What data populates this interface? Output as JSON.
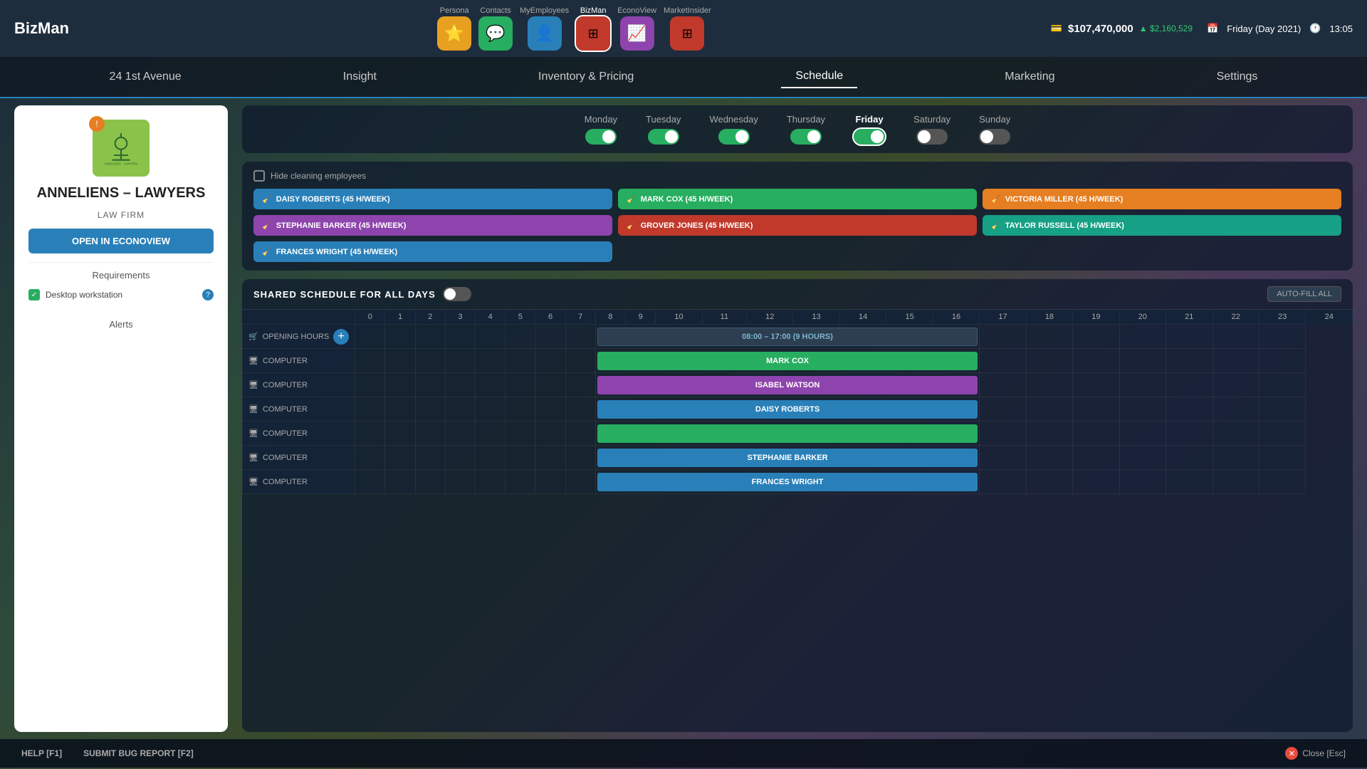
{
  "app": {
    "logo": "BizMan",
    "nav": [
      {
        "id": "persona",
        "label": "Persona",
        "icon": "⭐",
        "color": "#e8a020"
      },
      {
        "id": "contacts",
        "label": "Contacts",
        "icon": "💬",
        "color": "#27ae60"
      },
      {
        "id": "myemployees",
        "label": "MyEmployees",
        "icon": "👤",
        "color": "#2980b9"
      },
      {
        "id": "bizman",
        "label": "BizMan",
        "icon": "▦",
        "color": "#c0392b",
        "active": true
      },
      {
        "id": "econoview",
        "label": "EconoView",
        "icon": "📈",
        "color": "#8e44ad"
      },
      {
        "id": "marketinsider",
        "label": "MarketInsider",
        "icon": "▦",
        "color": "#c0392b"
      }
    ],
    "money": "$107,470,000",
    "money_change": "▲ $2,160,529",
    "date": "Friday (Day 2021)",
    "time": "13:05"
  },
  "subnav": {
    "items": [
      {
        "id": "address",
        "label": "24 1st Avenue"
      },
      {
        "id": "insight",
        "label": "Insight"
      },
      {
        "id": "inventory",
        "label": "Inventory & Pricing"
      },
      {
        "id": "schedule",
        "label": "Schedule",
        "active": true
      },
      {
        "id": "marketing",
        "label": "Marketing"
      },
      {
        "id": "settings",
        "label": "Settings"
      }
    ]
  },
  "company": {
    "name": "ANNELIENS – LAWYERS",
    "type": "LAW FIRM",
    "open_btn": "OPEN IN ECONOVIEW",
    "requirements_label": "Requirements",
    "requirement_item": "Desktop workstation",
    "alerts_label": "Alerts"
  },
  "schedule": {
    "days": [
      {
        "label": "Monday",
        "on": true
      },
      {
        "label": "Tuesday",
        "on": true
      },
      {
        "label": "Wednesday",
        "on": true
      },
      {
        "label": "Thursday",
        "on": true
      },
      {
        "label": "Friday",
        "on": true,
        "active": true
      },
      {
        "label": "Saturday",
        "on": false
      },
      {
        "label": "Sunday",
        "on": false
      }
    ],
    "hide_cleaning_label": "Hide cleaning employees",
    "employees": [
      {
        "name": "DAISY ROBERTS (45 H/WEEK)",
        "color": "blue",
        "col": 1
      },
      {
        "name": "MARK COX (45 H/WEEK)",
        "color": "green",
        "col": 2
      },
      {
        "name": "VICTORIA MILLER (45 H/WEEK)",
        "color": "orange",
        "col": 3
      },
      {
        "name": "STEPHANIE BARKER (45 H/WEEK)",
        "color": "purple",
        "col": 1
      },
      {
        "name": "GROVER JONES (45 H/WEEK)",
        "color": "red",
        "col": 2
      },
      {
        "name": "TAYLOR RUSSELL (45 H/WEEK)",
        "color": "teal",
        "col": 3
      },
      {
        "name": "FRANCES WRIGHT (45 H/WEEK)",
        "color": "blue",
        "col": 1
      }
    ],
    "shared_schedule_label": "SHARED SCHEDULE FOR ALL DAYS",
    "auto_fill_label": "AUTO-FILL ALL",
    "time_hours": [
      "0",
      "1",
      "2",
      "3",
      "4",
      "5",
      "6",
      "7",
      "8",
      "9",
      "10",
      "11",
      "12",
      "13",
      "14",
      "15",
      "16",
      "17",
      "18",
      "19",
      "20",
      "21",
      "22",
      "23",
      "24"
    ],
    "rows": [
      {
        "type": "opening",
        "label": "OPENING HOURS",
        "icon": "🛒",
        "bar": "08:00 – 17:00 (9 HOURS)",
        "bar_start": 8,
        "bar_end": 17
      },
      {
        "type": "computer",
        "label": "COMPUTER",
        "icon": "🖥",
        "bar": "MARK COX",
        "bar_color": "green",
        "bar_start": 8,
        "bar_end": 17
      },
      {
        "type": "computer",
        "label": "COMPUTER",
        "icon": "🖥",
        "bar": "ISABEL WATSON",
        "bar_color": "purple",
        "bar_start": 8,
        "bar_end": 17
      },
      {
        "type": "computer",
        "label": "COMPUTER",
        "icon": "🖥",
        "bar": "DAISY ROBERTS",
        "bar_color": "blue",
        "bar_start": 8,
        "bar_end": 17
      },
      {
        "type": "computer",
        "label": "COMPUTER",
        "icon": "🖥",
        "bar": "",
        "bar_color": "green2",
        "bar_start": 8,
        "bar_end": 17
      },
      {
        "type": "computer",
        "label": "COMPUTER",
        "icon": "🖥",
        "bar": "STEPHANIE BARKER",
        "bar_color": "blue",
        "bar_start": 8,
        "bar_end": 17
      },
      {
        "type": "computer",
        "label": "COMPUTER",
        "icon": "🖥",
        "bar": "FRANCES WRIGHT",
        "bar_color": "blue",
        "bar_start": 8,
        "bar_end": 17
      }
    ]
  },
  "bottom": {
    "help_label": "HELP [F1]",
    "bug_label": "SUBMIT BUG REPORT [F2]",
    "close_label": "Close [Esc]"
  }
}
